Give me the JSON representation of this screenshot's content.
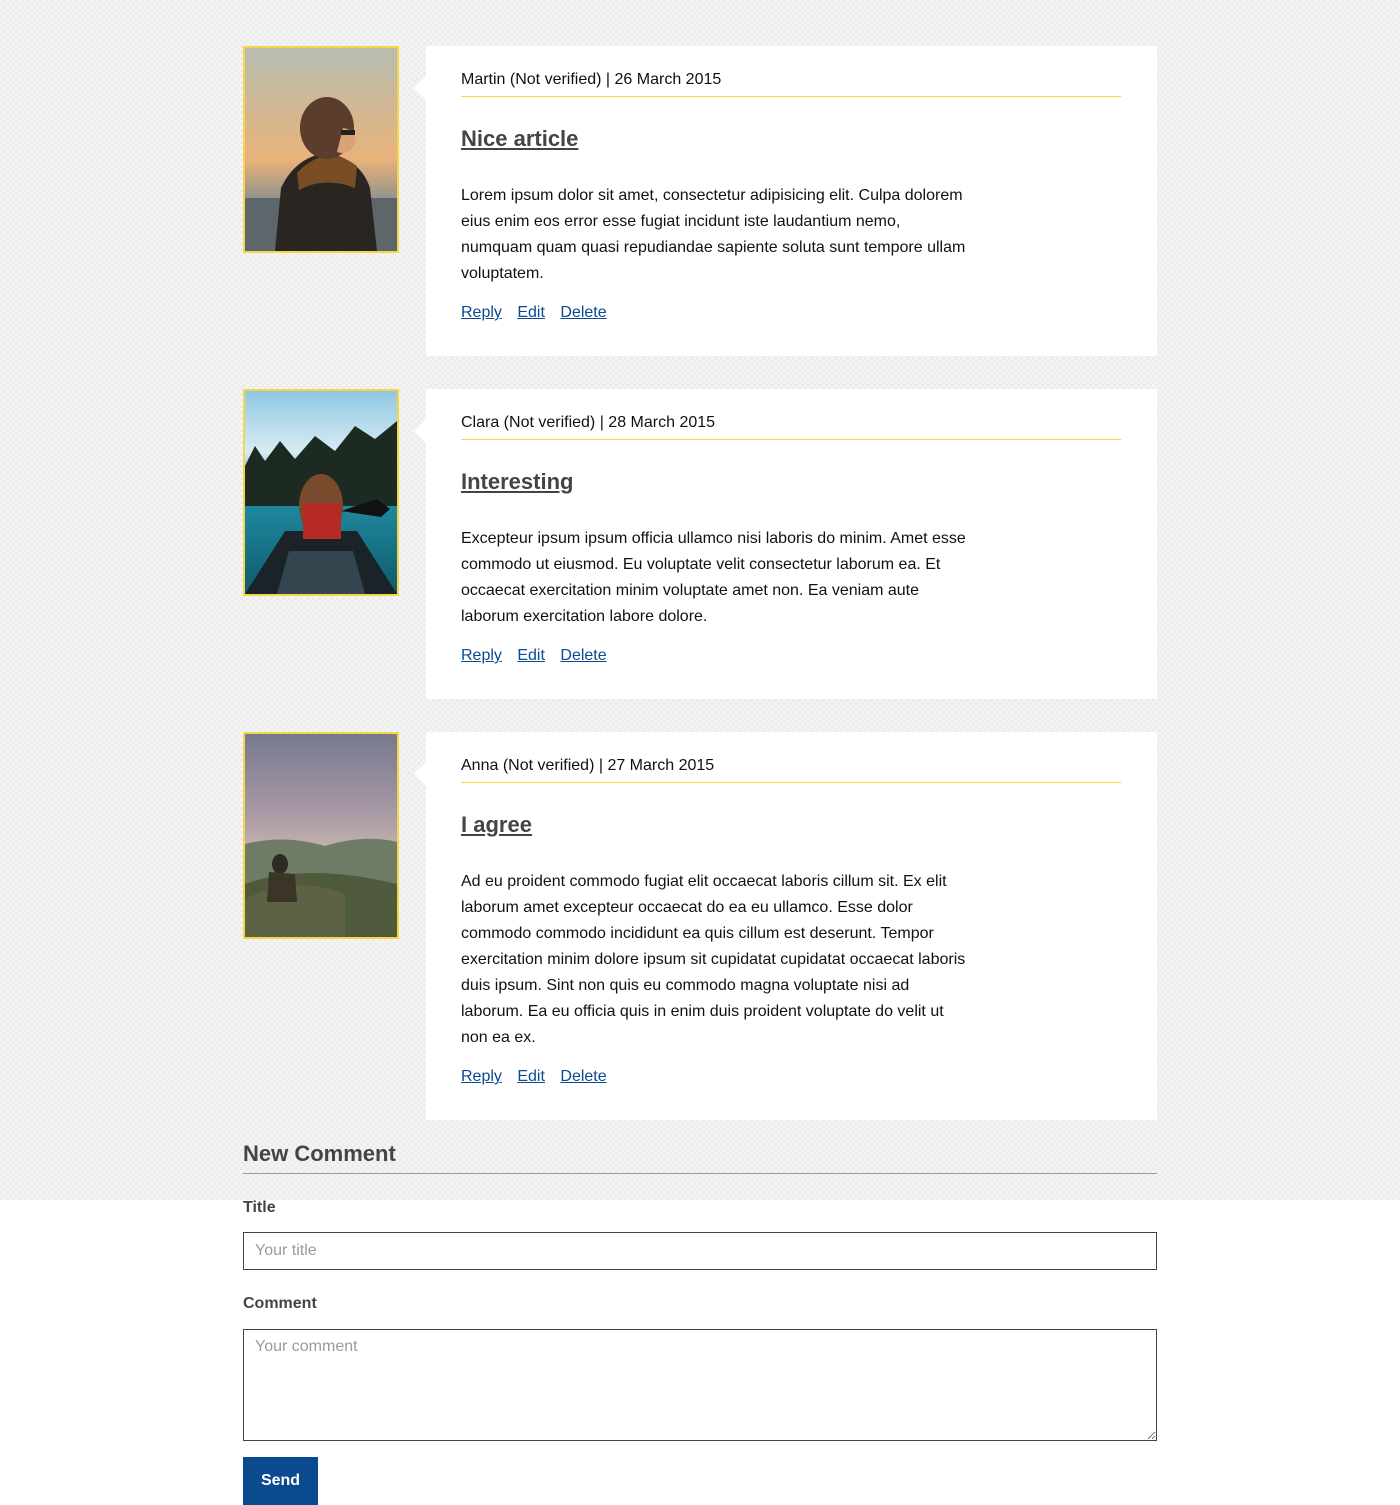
{
  "comments": [
    {
      "avatar": "avatar-person-scarf-sunset",
      "meta": "Martin (Not verified) | 26 March 2015",
      "title": "Nice article",
      "body": "Lorem ipsum dolor sit amet, consectetur adipisicing elit. Culpa dolorem eius enim eos error esse fugiat incidunt iste laudantium nemo, numquam quam quasi repudiandae sapiente soluta sunt tempore ullam voluptatem.",
      "actions": {
        "reply": "Reply",
        "edit": "Edit",
        "delete": "Delete"
      }
    },
    {
      "avatar": "avatar-woman-canoe-lake",
      "meta": "Clara (Not verified) | 28 March 2015",
      "title": "Interesting",
      "body": "Excepteur ipsum ipsum officia ullamco nisi laboris do minim. Amet esse commodo ut eiusmod. Eu voluptate velit consectetur laborum ea. Et occaecat exercitation minim voluptate amet non. Ea veniam aute laborum exercitation labore dolore.",
      "actions": {
        "reply": "Reply",
        "edit": "Edit",
        "delete": "Delete"
      }
    },
    {
      "avatar": "avatar-person-mountain-fog",
      "meta": "Anna (Not verified) | 27 March 2015",
      "title": "I agree",
      "body": "Ad eu proident commodo fugiat elit occaecat laboris cillum sit. Ex elit laborum amet excepteur occaecat do ea eu ullamco. Esse dolor commodo commodo incididunt ea quis cillum est deserunt. Tempor exercitation minim dolore ipsum sit cupidatat cupidatat occaecat laboris duis ipsum. Sint non quis eu commodo magna voluptate nisi ad laborum. Ea eu officia quis in enim duis proident voluptate do velit ut non ea ex.",
      "actions": {
        "reply": "Reply",
        "edit": "Edit",
        "delete": "Delete"
      }
    }
  ],
  "form": {
    "heading": "New Comment",
    "title_label": "Title",
    "title_placeholder": "Your title",
    "comment_label": "Comment",
    "comment_placeholder": "Your comment",
    "send_label": "Send"
  },
  "colors": {
    "accent_yellow": "#f6d645",
    "link_blue": "#0b4a8f",
    "button_blue": "#0b4a8f"
  }
}
